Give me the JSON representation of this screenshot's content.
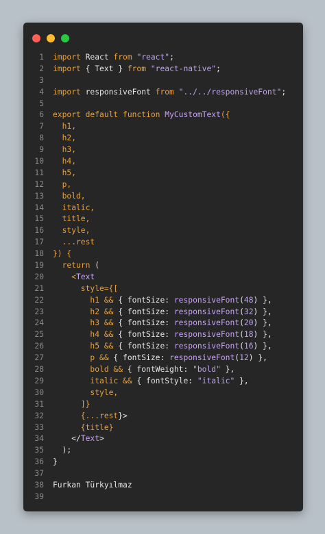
{
  "window": {
    "controls": [
      "close",
      "minimize",
      "maximize"
    ],
    "colors": {
      "close": "#fe5f57",
      "minimize": "#febc2e",
      "maximize": "#28c840",
      "keyword": "#e8a23d",
      "string": "#bfa7e8",
      "function": "#c9a2f7",
      "text": "#e6e6e6"
    }
  },
  "code": {
    "lines": [
      {
        "n": "1",
        "tokens": [
          {
            "t": "import",
            "c": "kw"
          },
          {
            "t": " React ",
            "c": "pl"
          },
          {
            "t": "from",
            "c": "kw"
          },
          {
            "t": " ",
            "c": "pl"
          },
          {
            "t": "\"react\"",
            "c": "str"
          },
          {
            "t": ";",
            "c": "pl"
          }
        ]
      },
      {
        "n": "2",
        "tokens": [
          {
            "t": "import",
            "c": "kw"
          },
          {
            "t": " { Text } ",
            "c": "pl"
          },
          {
            "t": "from",
            "c": "kw"
          },
          {
            "t": " ",
            "c": "pl"
          },
          {
            "t": "\"react-native\"",
            "c": "str"
          },
          {
            "t": ";",
            "c": "pl"
          }
        ]
      },
      {
        "n": "3",
        "tokens": []
      },
      {
        "n": "4",
        "tokens": [
          {
            "t": "import",
            "c": "kw"
          },
          {
            "t": " responsiveFont ",
            "c": "pl"
          },
          {
            "t": "from",
            "c": "kw"
          },
          {
            "t": " ",
            "c": "pl"
          },
          {
            "t": "\"../../responsiveFont\"",
            "c": "str"
          },
          {
            "t": ";",
            "c": "pl"
          }
        ]
      },
      {
        "n": "5",
        "tokens": []
      },
      {
        "n": "6",
        "tokens": [
          {
            "t": "export",
            "c": "kw"
          },
          {
            "t": " ",
            "c": "pl"
          },
          {
            "t": "default",
            "c": "kw"
          },
          {
            "t": " ",
            "c": "pl"
          },
          {
            "t": "function",
            "c": "kw"
          },
          {
            "t": " ",
            "c": "pl"
          },
          {
            "t": "MyCustomText",
            "c": "fn"
          },
          {
            "t": "({",
            "c": "kw"
          }
        ]
      },
      {
        "n": "7",
        "tokens": [
          {
            "t": "  h1,",
            "c": "kw"
          }
        ]
      },
      {
        "n": "8",
        "tokens": [
          {
            "t": "  h2,",
            "c": "kw"
          }
        ]
      },
      {
        "n": "9",
        "tokens": [
          {
            "t": "  h3,",
            "c": "kw"
          }
        ]
      },
      {
        "n": "10",
        "tokens": [
          {
            "t": "  h4,",
            "c": "kw"
          }
        ]
      },
      {
        "n": "11",
        "tokens": [
          {
            "t": "  h5,",
            "c": "kw"
          }
        ]
      },
      {
        "n": "12",
        "tokens": [
          {
            "t": "  p,",
            "c": "kw"
          }
        ]
      },
      {
        "n": "13",
        "tokens": [
          {
            "t": "  bold,",
            "c": "kw"
          }
        ]
      },
      {
        "n": "14",
        "tokens": [
          {
            "t": "  italic,",
            "c": "kw"
          }
        ]
      },
      {
        "n": "15",
        "tokens": [
          {
            "t": "  title,",
            "c": "kw"
          }
        ]
      },
      {
        "n": "16",
        "tokens": [
          {
            "t": "  style,",
            "c": "kw"
          }
        ]
      },
      {
        "n": "17",
        "tokens": [
          {
            "t": "  ...rest",
            "c": "kw"
          }
        ]
      },
      {
        "n": "18",
        "tokens": [
          {
            "t": "}) {",
            "c": "kw"
          }
        ]
      },
      {
        "n": "19",
        "tokens": [
          {
            "t": "  ",
            "c": "pl"
          },
          {
            "t": "return",
            "c": "kw"
          },
          {
            "t": " (",
            "c": "pl"
          }
        ]
      },
      {
        "n": "20",
        "tokens": [
          {
            "t": "    <",
            "c": "kw"
          },
          {
            "t": "Text",
            "c": "fn"
          }
        ]
      },
      {
        "n": "21",
        "tokens": [
          {
            "t": "      style",
            "c": "kw"
          },
          {
            "t": "={[",
            "c": "kw"
          }
        ]
      },
      {
        "n": "22",
        "tokens": [
          {
            "t": "        h1 ",
            "c": "kw"
          },
          {
            "t": "&&",
            "c": "kw"
          },
          {
            "t": " { fontSize: ",
            "c": "pl"
          },
          {
            "t": "responsiveFont",
            "c": "fn"
          },
          {
            "t": "(",
            "c": "pl"
          },
          {
            "t": "48",
            "c": "str"
          },
          {
            "t": ") },",
            "c": "pl"
          }
        ]
      },
      {
        "n": "23",
        "tokens": [
          {
            "t": "        h2 ",
            "c": "kw"
          },
          {
            "t": "&&",
            "c": "kw"
          },
          {
            "t": " { fontSize: ",
            "c": "pl"
          },
          {
            "t": "responsiveFont",
            "c": "fn"
          },
          {
            "t": "(",
            "c": "pl"
          },
          {
            "t": "32",
            "c": "str"
          },
          {
            "t": ") },",
            "c": "pl"
          }
        ]
      },
      {
        "n": "24",
        "tokens": [
          {
            "t": "        h3 ",
            "c": "kw"
          },
          {
            "t": "&&",
            "c": "kw"
          },
          {
            "t": " { fontSize: ",
            "c": "pl"
          },
          {
            "t": "responsiveFont",
            "c": "fn"
          },
          {
            "t": "(",
            "c": "pl"
          },
          {
            "t": "20",
            "c": "str"
          },
          {
            "t": ") },",
            "c": "pl"
          }
        ]
      },
      {
        "n": "25",
        "tokens": [
          {
            "t": "        h4 ",
            "c": "kw"
          },
          {
            "t": "&&",
            "c": "kw"
          },
          {
            "t": " { fontSize: ",
            "c": "pl"
          },
          {
            "t": "responsiveFont",
            "c": "fn"
          },
          {
            "t": "(",
            "c": "pl"
          },
          {
            "t": "18",
            "c": "str"
          },
          {
            "t": ") },",
            "c": "pl"
          }
        ]
      },
      {
        "n": "26",
        "tokens": [
          {
            "t": "        h5 ",
            "c": "kw"
          },
          {
            "t": "&&",
            "c": "kw"
          },
          {
            "t": " { fontSize: ",
            "c": "pl"
          },
          {
            "t": "responsiveFont",
            "c": "fn"
          },
          {
            "t": "(",
            "c": "pl"
          },
          {
            "t": "16",
            "c": "str"
          },
          {
            "t": ") },",
            "c": "pl"
          }
        ]
      },
      {
        "n": "27",
        "tokens": [
          {
            "t": "        p ",
            "c": "kw"
          },
          {
            "t": "&&",
            "c": "kw"
          },
          {
            "t": " { fontSize: ",
            "c": "pl"
          },
          {
            "t": "responsiveFont",
            "c": "fn"
          },
          {
            "t": "(",
            "c": "pl"
          },
          {
            "t": "12",
            "c": "str"
          },
          {
            "t": ") },",
            "c": "pl"
          }
        ]
      },
      {
        "n": "28",
        "tokens": [
          {
            "t": "        bold ",
            "c": "kw"
          },
          {
            "t": "&&",
            "c": "kw"
          },
          {
            "t": " { fontWeight: ",
            "c": "pl"
          },
          {
            "t": "\"bold\"",
            "c": "str"
          },
          {
            "t": " },",
            "c": "pl"
          }
        ]
      },
      {
        "n": "29",
        "tokens": [
          {
            "t": "        italic ",
            "c": "kw"
          },
          {
            "t": "&&",
            "c": "kw"
          },
          {
            "t": " { fontStyle: ",
            "c": "pl"
          },
          {
            "t": "\"italic\"",
            "c": "str"
          },
          {
            "t": " },",
            "c": "pl"
          }
        ]
      },
      {
        "n": "30",
        "tokens": [
          {
            "t": "        style,",
            "c": "kw"
          }
        ]
      },
      {
        "n": "31",
        "tokens": [
          {
            "t": "      ]}",
            "c": "kw"
          }
        ]
      },
      {
        "n": "32",
        "tokens": [
          {
            "t": "      {",
            "c": "kw"
          },
          {
            "t": "...rest",
            "c": "kw"
          },
          {
            "t": "}>",
            "c": "pl"
          }
        ]
      },
      {
        "n": "33",
        "tokens": [
          {
            "t": "      {title}",
            "c": "kw"
          }
        ]
      },
      {
        "n": "34",
        "tokens": [
          {
            "t": "    </",
            "c": "pl"
          },
          {
            "t": "Text",
            "c": "fn"
          },
          {
            "t": ">",
            "c": "pl"
          }
        ]
      },
      {
        "n": "35",
        "tokens": [
          {
            "t": "  );",
            "c": "pl"
          }
        ]
      },
      {
        "n": "36",
        "tokens": [
          {
            "t": "}",
            "c": "pl"
          }
        ]
      },
      {
        "n": "37",
        "tokens": []
      },
      {
        "n": "38",
        "tokens": [
          {
            "t": "Furkan Türkyılmaz",
            "c": "pl"
          }
        ]
      },
      {
        "n": "39",
        "tokens": []
      }
    ]
  }
}
